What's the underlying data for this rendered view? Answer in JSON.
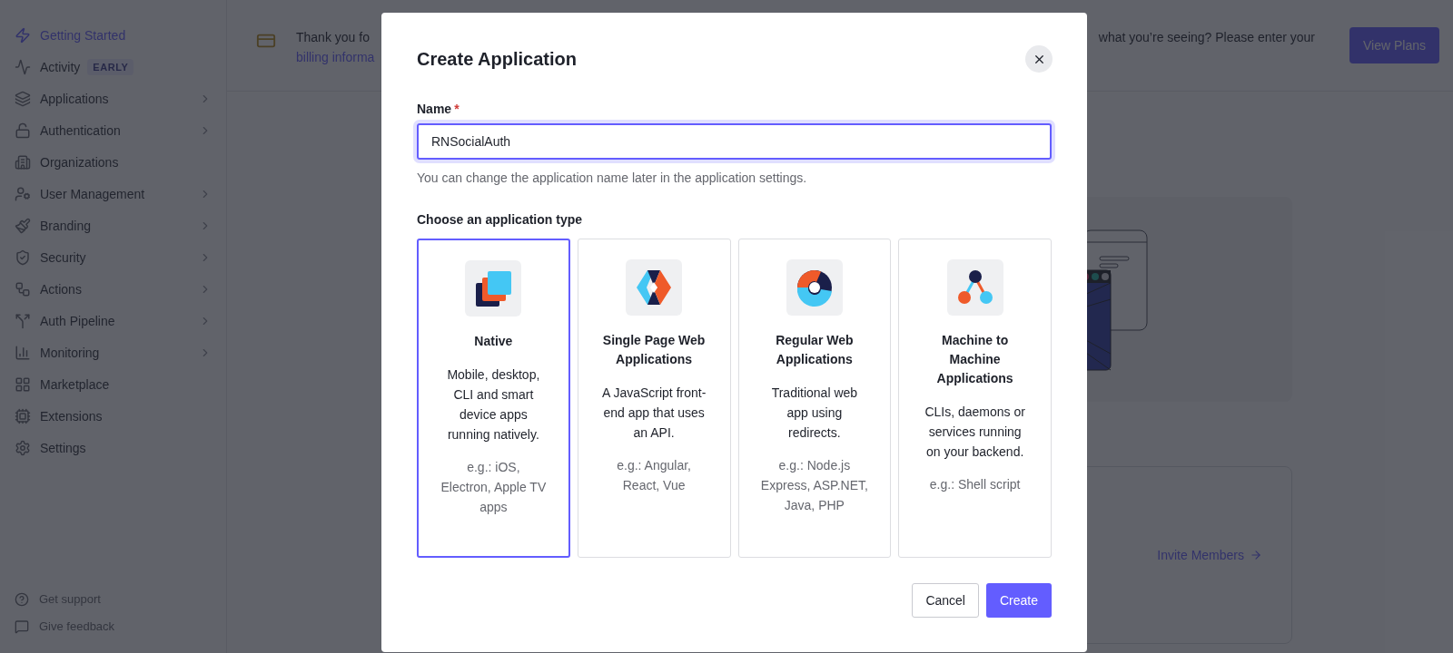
{
  "sidebar": {
    "items": [
      {
        "label": "Getting Started",
        "selected": true,
        "expandable": false
      },
      {
        "label": "Activity",
        "badge": "EARLY",
        "selected": false,
        "expandable": false
      },
      {
        "label": "Applications",
        "selected": false,
        "expandable": true
      },
      {
        "label": "Authentication",
        "selected": false,
        "expandable": true
      },
      {
        "label": "Organizations",
        "selected": false,
        "expandable": false
      },
      {
        "label": "User Management",
        "selected": false,
        "expandable": true
      },
      {
        "label": "Branding",
        "selected": false,
        "expandable": true
      },
      {
        "label": "Security",
        "selected": false,
        "expandable": true
      },
      {
        "label": "Actions",
        "selected": false,
        "expandable": true
      },
      {
        "label": "Auth Pipeline",
        "selected": false,
        "expandable": true
      },
      {
        "label": "Monitoring",
        "selected": false,
        "expandable": true
      },
      {
        "label": "Marketplace",
        "selected": false,
        "expandable": false
      },
      {
        "label": "Extensions",
        "selected": false,
        "expandable": false
      },
      {
        "label": "Settings",
        "selected": false,
        "expandable": false
      }
    ],
    "footer_links": [
      "Get support",
      "Give feedback"
    ]
  },
  "banner": {
    "text_start": "Thank you fo",
    "link": "billing informa",
    "text_end": "what you’re seeing? Please enter your",
    "button": "View Plans"
  },
  "invite_card": {
    "link": "Invite Members"
  },
  "dialog": {
    "title": "Create Application",
    "name_field": {
      "label": "Name",
      "required_mark": "*",
      "value": "RNSocialAuth",
      "focused": true,
      "help": "You can change the application name later in the application settings."
    },
    "type_heading": "Choose an application type",
    "app_types": [
      {
        "kind": "native",
        "title": "Native",
        "description": "Mobile, desktop, CLI and smart device apps running natively.",
        "example": "e.g.: iOS, Electron, Apple TV apps",
        "selected": true
      },
      {
        "kind": "spa",
        "title": "Single Page Web Applications",
        "description": "A JavaScript front-end app that uses an API.",
        "example": "e.g.: Angular, React, Vue",
        "selected": false
      },
      {
        "kind": "regular",
        "title": "Regular Web Applications",
        "description": "Traditional web app using redirects.",
        "example": "e.g.: Node.js Express, ASP.NET, Java, PHP",
        "selected": false
      },
      {
        "kind": "m2m",
        "title": "Machine to Machine Applications",
        "description": "CLIs, daemons or services running on your backend.",
        "example": "e.g.: Shell script",
        "selected": false
      }
    ],
    "buttons": {
      "cancel": "Cancel",
      "create": "Create"
    }
  }
}
